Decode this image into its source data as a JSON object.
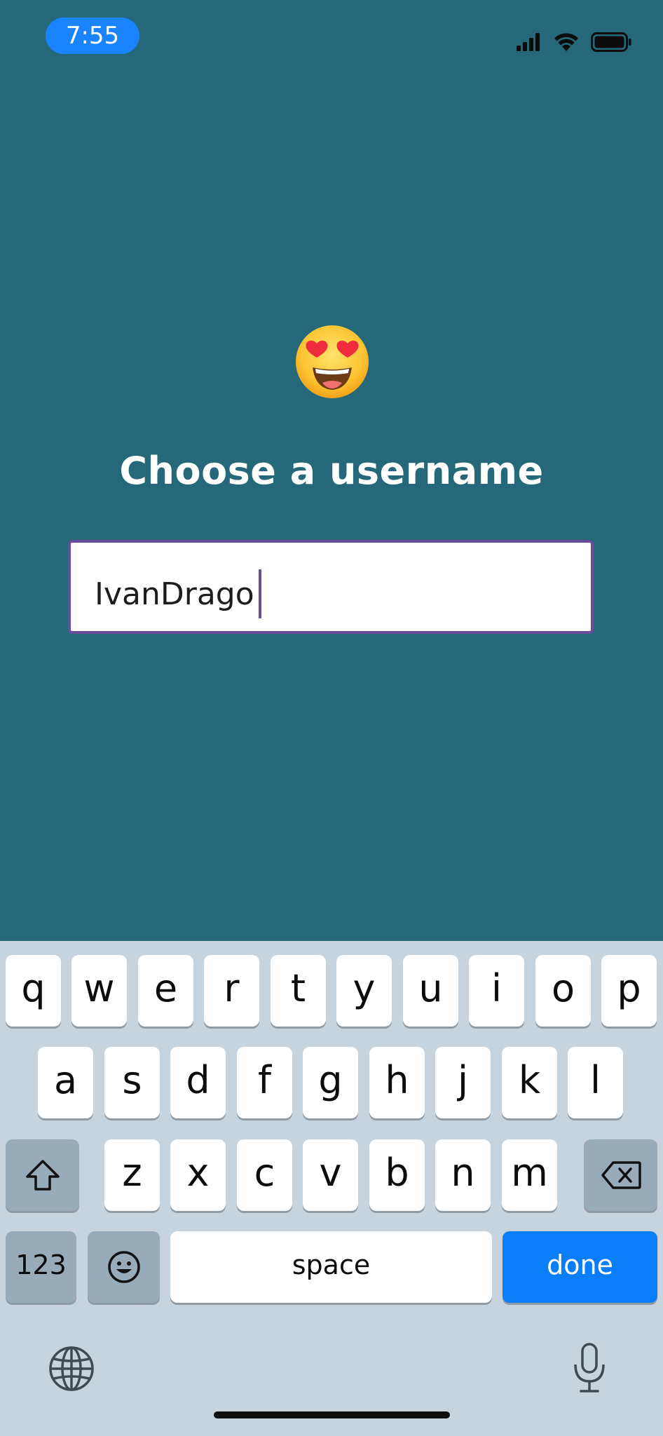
{
  "status_bar": {
    "time": "7:55",
    "icons": [
      "cellular-signal-icon",
      "wifi-icon",
      "battery-icon"
    ]
  },
  "screen": {
    "emoji": "smiling-face-with-heart-eyes",
    "title": "Choose a username",
    "username_value": "IvanDrago"
  },
  "keyboard": {
    "row1": [
      "q",
      "w",
      "e",
      "r",
      "t",
      "y",
      "u",
      "i",
      "o",
      "p"
    ],
    "row2": [
      "a",
      "s",
      "d",
      "f",
      "g",
      "h",
      "j",
      "k",
      "l"
    ],
    "row3": [
      "z",
      "x",
      "c",
      "v",
      "b",
      "n",
      "m"
    ],
    "numbers_label": "123",
    "space_label": "space",
    "done_label": "done",
    "icons": [
      "shift-icon",
      "backspace-icon",
      "emoji-keyboard-icon",
      "globe-icon",
      "microphone-icon"
    ]
  },
  "colors": {
    "background": "#256879",
    "field_border": "#6a4c9c",
    "done_key": "#0a7ef8",
    "time_pill": "#1a83ff"
  }
}
